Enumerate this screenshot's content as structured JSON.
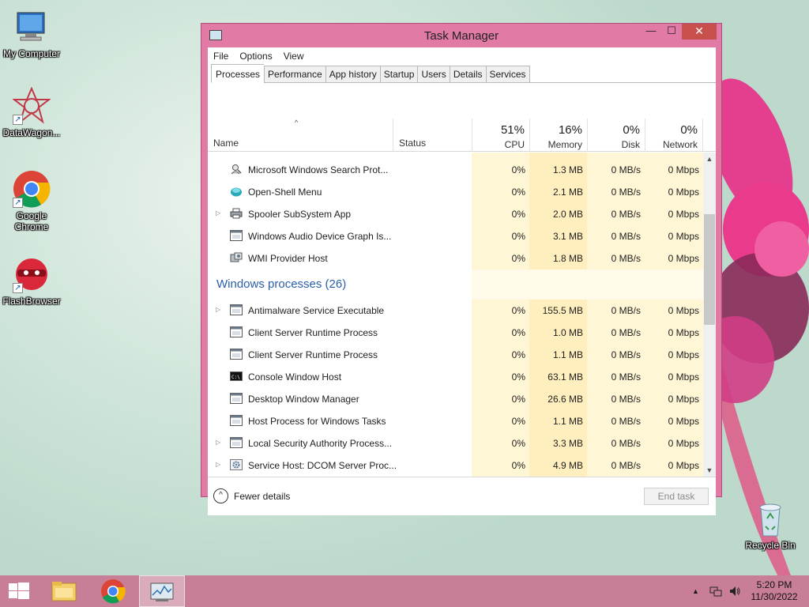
{
  "desktop": {
    "icons": [
      {
        "label": "My Computer",
        "icon": "computer-icon"
      },
      {
        "label": "DataWagon...",
        "icon": "datawagon-icon"
      },
      {
        "label": "Google Chrome",
        "icon": "chrome-icon"
      },
      {
        "label": "FlashBrowser",
        "icon": "flashbrowser-icon"
      },
      {
        "label": "Recycle Bin",
        "icon": "recycle-bin-icon"
      }
    ]
  },
  "window": {
    "title": "Task Manager",
    "controls": {
      "minimize": "—",
      "maximize": "☐",
      "close": "✕"
    },
    "menu": [
      "File",
      "Options",
      "View"
    ],
    "tabs": [
      "Processes",
      "Performance",
      "App history",
      "Startup",
      "Users",
      "Details",
      "Services"
    ],
    "active_tab": "Processes",
    "columns": {
      "name": "Name",
      "status": "Status",
      "cpu": {
        "pct": "51%",
        "label": "CPU"
      },
      "memory": {
        "pct": "16%",
        "label": "Memory"
      },
      "disk": {
        "pct": "0%",
        "label": "Disk"
      },
      "network": {
        "pct": "0%",
        "label": "Network"
      }
    },
    "rows_top": [
      {
        "name": "Microsoft Windows Search Prot...",
        "cpu": "0%",
        "memory": "1.3 MB",
        "disk": "0 MB/s",
        "network": "0 Mbps",
        "expandable": false,
        "icon": "search-protocol-icon"
      },
      {
        "name": "Open-Shell Menu",
        "cpu": "0%",
        "memory": "2.1 MB",
        "disk": "0 MB/s",
        "network": "0 Mbps",
        "expandable": false,
        "icon": "open-shell-icon"
      },
      {
        "name": "Spooler SubSystem App",
        "cpu": "0%",
        "memory": "2.0 MB",
        "disk": "0 MB/s",
        "network": "0 Mbps",
        "expandable": true,
        "icon": "printer-icon"
      },
      {
        "name": "Windows Audio Device Graph Is...",
        "cpu": "0%",
        "memory": "3.1 MB",
        "disk": "0 MB/s",
        "network": "0 Mbps",
        "expandable": false,
        "icon": "window-process-icon"
      },
      {
        "name": "WMI Provider Host",
        "cpu": "0%",
        "memory": "1.8 MB",
        "disk": "0 MB/s",
        "network": "0 Mbps",
        "expandable": false,
        "icon": "wmi-icon"
      }
    ],
    "group": {
      "title": "Windows processes (26)"
    },
    "rows_bottom": [
      {
        "name": "Antimalware Service Executable",
        "cpu": "0%",
        "memory": "155.5 MB",
        "disk": "0 MB/s",
        "network": "0 Mbps",
        "expandable": true,
        "icon": "window-process-icon"
      },
      {
        "name": "Client Server Runtime Process",
        "cpu": "0%",
        "memory": "1.0 MB",
        "disk": "0 MB/s",
        "network": "0 Mbps",
        "expandable": false,
        "icon": "window-process-icon"
      },
      {
        "name": "Client Server Runtime Process",
        "cpu": "0%",
        "memory": "1.1 MB",
        "disk": "0 MB/s",
        "network": "0 Mbps",
        "expandable": false,
        "icon": "window-process-icon"
      },
      {
        "name": "Console Window Host",
        "cpu": "0%",
        "memory": "63.1 MB",
        "disk": "0 MB/s",
        "network": "0 Mbps",
        "expandable": false,
        "icon": "console-icon"
      },
      {
        "name": "Desktop Window Manager",
        "cpu": "0%",
        "memory": "26.6 MB",
        "disk": "0 MB/s",
        "network": "0 Mbps",
        "expandable": false,
        "icon": "window-process-icon"
      },
      {
        "name": "Host Process for Windows Tasks",
        "cpu": "0%",
        "memory": "1.1 MB",
        "disk": "0 MB/s",
        "network": "0 Mbps",
        "expandable": false,
        "icon": "window-process-icon"
      },
      {
        "name": "Local Security Authority Process...",
        "cpu": "0%",
        "memory": "3.3 MB",
        "disk": "0 MB/s",
        "network": "0 Mbps",
        "expandable": true,
        "icon": "window-process-icon"
      },
      {
        "name": "Service Host: DCOM Server Proc...",
        "cpu": "0%",
        "memory": "4.9 MB",
        "disk": "0 MB/s",
        "network": "0 Mbps",
        "expandable": true,
        "icon": "gear-icon"
      }
    ],
    "footer": {
      "fewer_details": "Fewer details",
      "end_task": "End task"
    }
  },
  "taskbar": {
    "apps": [
      "start-icon",
      "file-explorer-icon",
      "chrome-icon",
      "task-manager-icon"
    ],
    "tray": {
      "chevron": "▲",
      "network": "network-icon",
      "volume": "volume-icon"
    },
    "clock": {
      "time": "5:20 PM",
      "date": "11/30/2022"
    }
  },
  "colors": {
    "heat_light": "#fff9e0",
    "heat_mid": "#fff2c4",
    "heat_memory": "#ffeaa8",
    "group_title": "#2a5ea8",
    "frame": "#e27aa6"
  }
}
